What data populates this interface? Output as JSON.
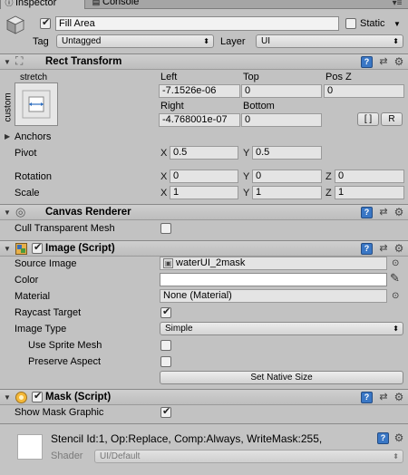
{
  "tabs": [
    {
      "label": "Inspector",
      "icon": "info-icon"
    },
    {
      "label": "Console",
      "icon": "console-icon"
    }
  ],
  "gameobject": {
    "name": "Fill Area",
    "active": true,
    "static_label": "Static",
    "static": false,
    "tag_label": "Tag",
    "tag_value": "Untagged",
    "layer_label": "Layer",
    "layer_value": "UI"
  },
  "rect_transform": {
    "title": "Rect Transform",
    "anchor_preset_top": "stretch",
    "anchor_preset_side": "custom",
    "col_left": "Left",
    "col_top": "Top",
    "col_posz": "Pos Z",
    "left": "-7.1526e-06",
    "top": "0",
    "posz": "0",
    "col_right": "Right",
    "col_bottom": "Bottom",
    "right": "-4.768001e-07",
    "bottom": "0",
    "raw_edit_button": "[ ]",
    "r_button": "R",
    "anchors_label": "Anchors",
    "pivot_label": "Pivot",
    "pivot_x": "0.5",
    "pivot_y": "0.5",
    "rotation_label": "Rotation",
    "rot_x": "0",
    "rot_y": "0",
    "rot_z": "0",
    "scale_label": "Scale",
    "scale_x": "1",
    "scale_y": "1",
    "scale_z": "1",
    "axis_x": "X",
    "axis_y": "Y",
    "axis_z": "Z"
  },
  "canvas_renderer": {
    "title": "Canvas Renderer",
    "cull_label": "Cull Transparent Mesh",
    "cull": false
  },
  "image": {
    "title": "Image (Script)",
    "enabled": true,
    "source_label": "Source Image",
    "source_value": "waterUI_2mask",
    "color_label": "Color",
    "color_value": "#ffffff",
    "material_label": "Material",
    "material_value": "None (Material)",
    "raycast_label": "Raycast Target",
    "raycast": true,
    "type_label": "Image Type",
    "type_value": "Simple",
    "sprite_mesh_label": "Use Sprite Mesh",
    "sprite_mesh": false,
    "preserve_label": "Preserve Aspect",
    "preserve": false,
    "native_size_button": "Set Native Size"
  },
  "mask": {
    "title": "Mask (Script)",
    "enabled": true,
    "show_graphic_label": "Show Mask Graphic",
    "show_graphic": true
  },
  "material_preview": {
    "stencil_text": "Stencil Id:1, Op:Replace, Comp:Always, WriteMask:255,",
    "shader_label": "Shader",
    "shader_value": "UI/Default"
  }
}
